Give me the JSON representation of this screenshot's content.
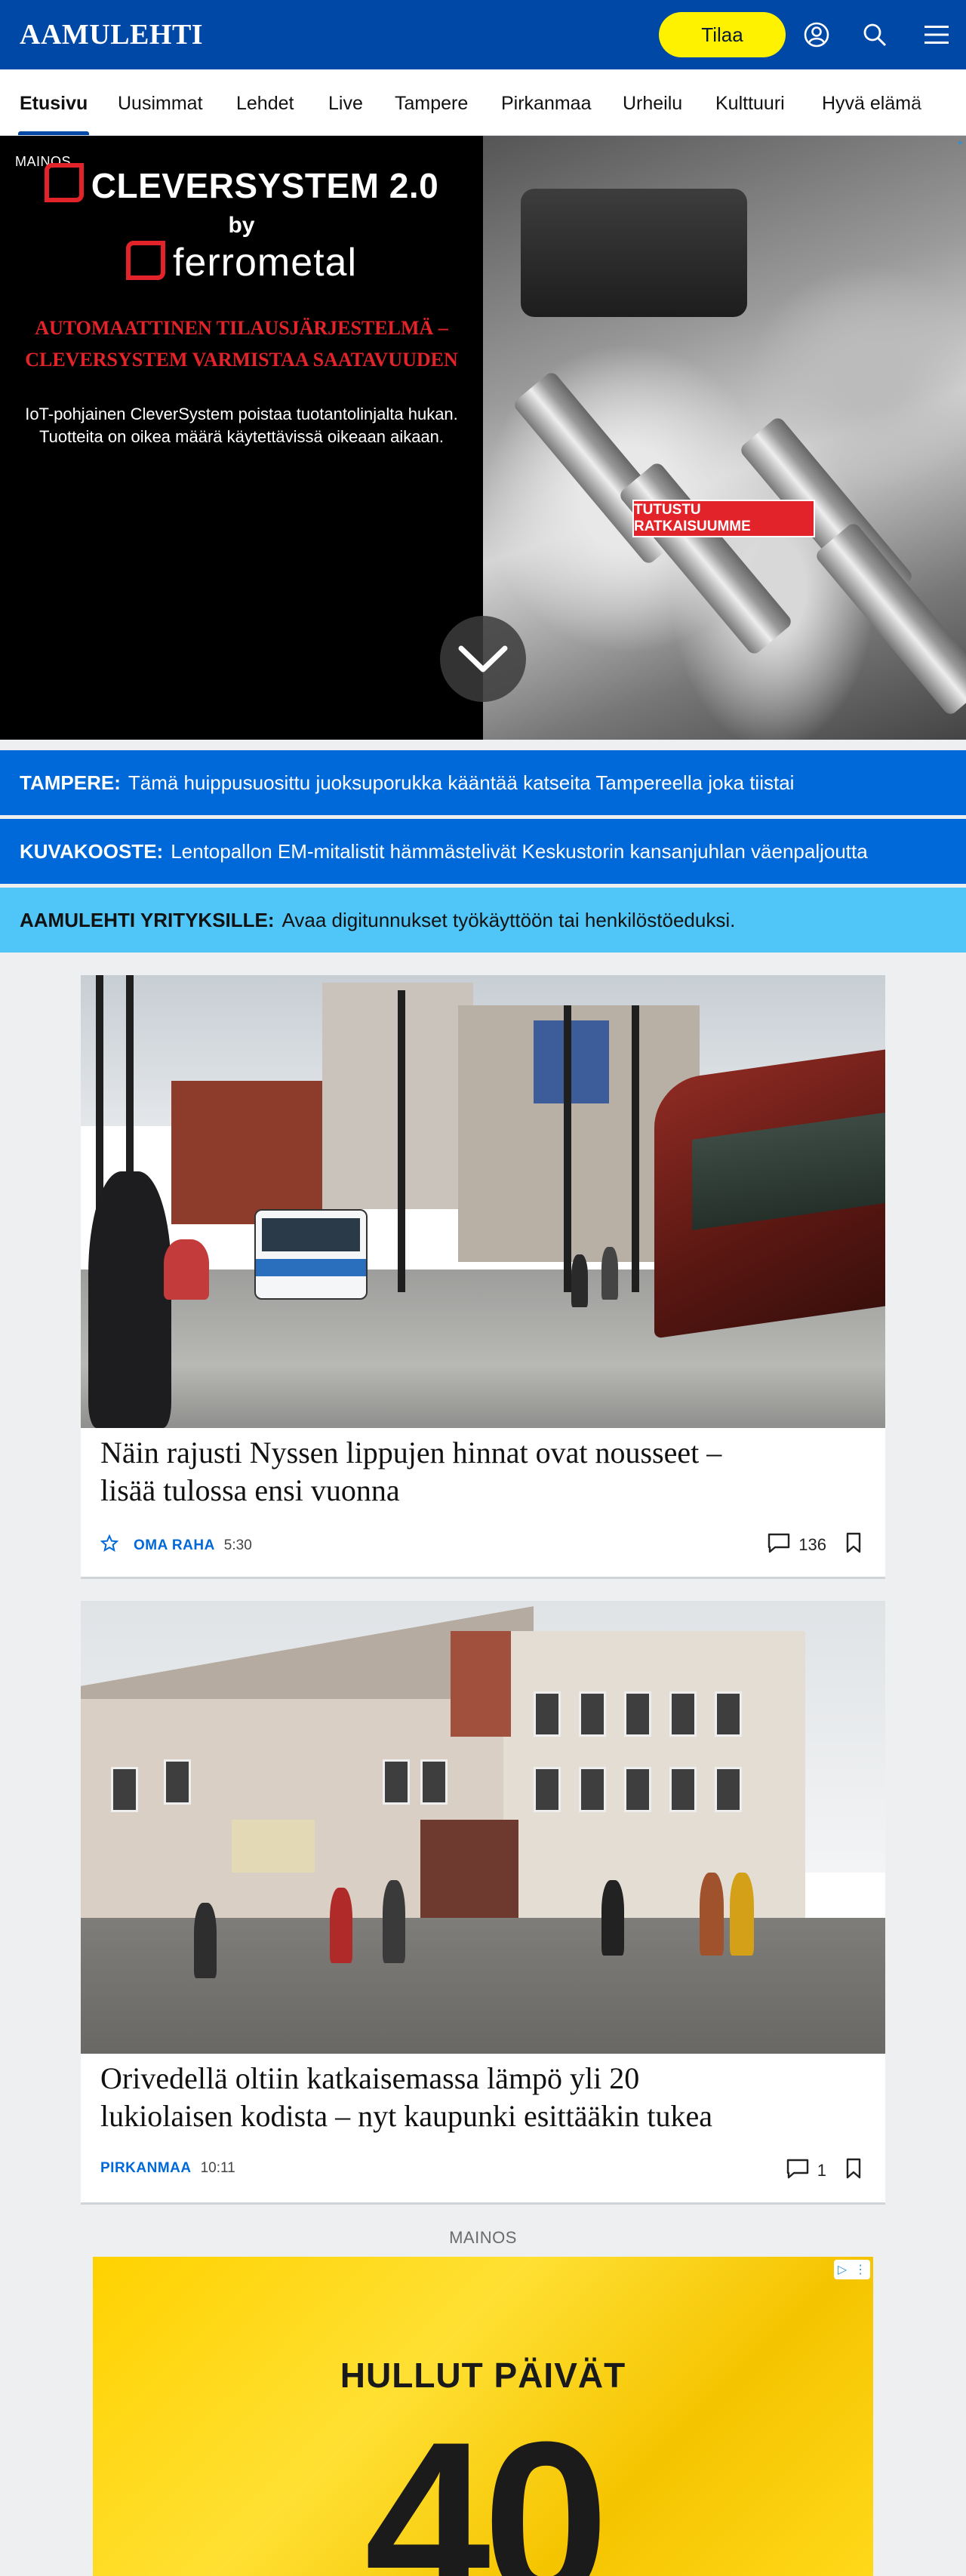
{
  "header": {
    "logo": "AAMULEHTI",
    "subscribe_label": "Tilaa",
    "icons": [
      "account-icon",
      "search-icon",
      "menu-icon"
    ]
  },
  "nav": {
    "items": [
      {
        "label": "Etusivu",
        "active": true
      },
      {
        "label": "Uusimmat"
      },
      {
        "label": "Lehdet"
      },
      {
        "label": "Live"
      },
      {
        "label": "Tampere"
      },
      {
        "label": "Pirkanmaa"
      },
      {
        "label": "Urheilu"
      },
      {
        "label": "Kulttuuri"
      },
      {
        "label": "Hyvä elämä"
      }
    ]
  },
  "top_ad": {
    "label": "MAINOS",
    "title": "CLEVERSYSTEM 2.0",
    "by": "by",
    "brand": "ferrometal",
    "headline_1": "AUTOMAATTINEN TILAUSJÄRJESTELMÄ –",
    "headline_2": "CLEVERSYSTEM VARMISTAA SAATAVUUDEN",
    "body_1": "IoT-pohjainen CleverSystem poistaa tuotantolinjalta hukan.",
    "body_2": "Tuotteita on oikea määrä käytettävissä oikeaan aikaan.",
    "cta": "TUTUSTU RATKAISUUMME",
    "colors": {
      "accent": "#e2232a"
    }
  },
  "teasers": [
    {
      "kicker": "TAMPERE:",
      "text": "Tämä huippusuosittu juoksuporukka kääntää katseita Tampereella joka tiistai"
    },
    {
      "kicker": "KUVAKOOSTE:",
      "text": "Lentopallon EM-mitalistit hämmästelivät Keskustorin kansanjuhlan väenpaljoutta"
    },
    {
      "kicker": "AAMULEHTI YRITYKSILLE:",
      "text": "Avaa digitunnukset työkäyttöön tai henkilöstöeduksi."
    }
  ],
  "articles": [
    {
      "title_1": "Näin rajusti Nyssen lippujen hinnat ovat nousseet –",
      "title_2": "lisää tulossa ensi vuonna",
      "section": "OMA RAHA",
      "time": "5:30",
      "comments": "136",
      "premium": true
    },
    {
      "title_1": "Orivedellä oltiin katkaisemassa lämpö yli 20",
      "title_2": "lukiolaisen kodista – nyt kaupunki esittääkin tukea",
      "section": "PIRKANMAA",
      "time": "10:11",
      "comments": "1",
      "premium": false
    }
  ],
  "bottom_ad": {
    "label": "MAINOS",
    "title": "HULLUT PÄIVÄT",
    "number": "40"
  },
  "colors": {
    "brand": "#0048a5",
    "subscribe": "#fff200",
    "teaser_blue": "#0069d9",
    "teaser_light": "#4fc6f7"
  }
}
